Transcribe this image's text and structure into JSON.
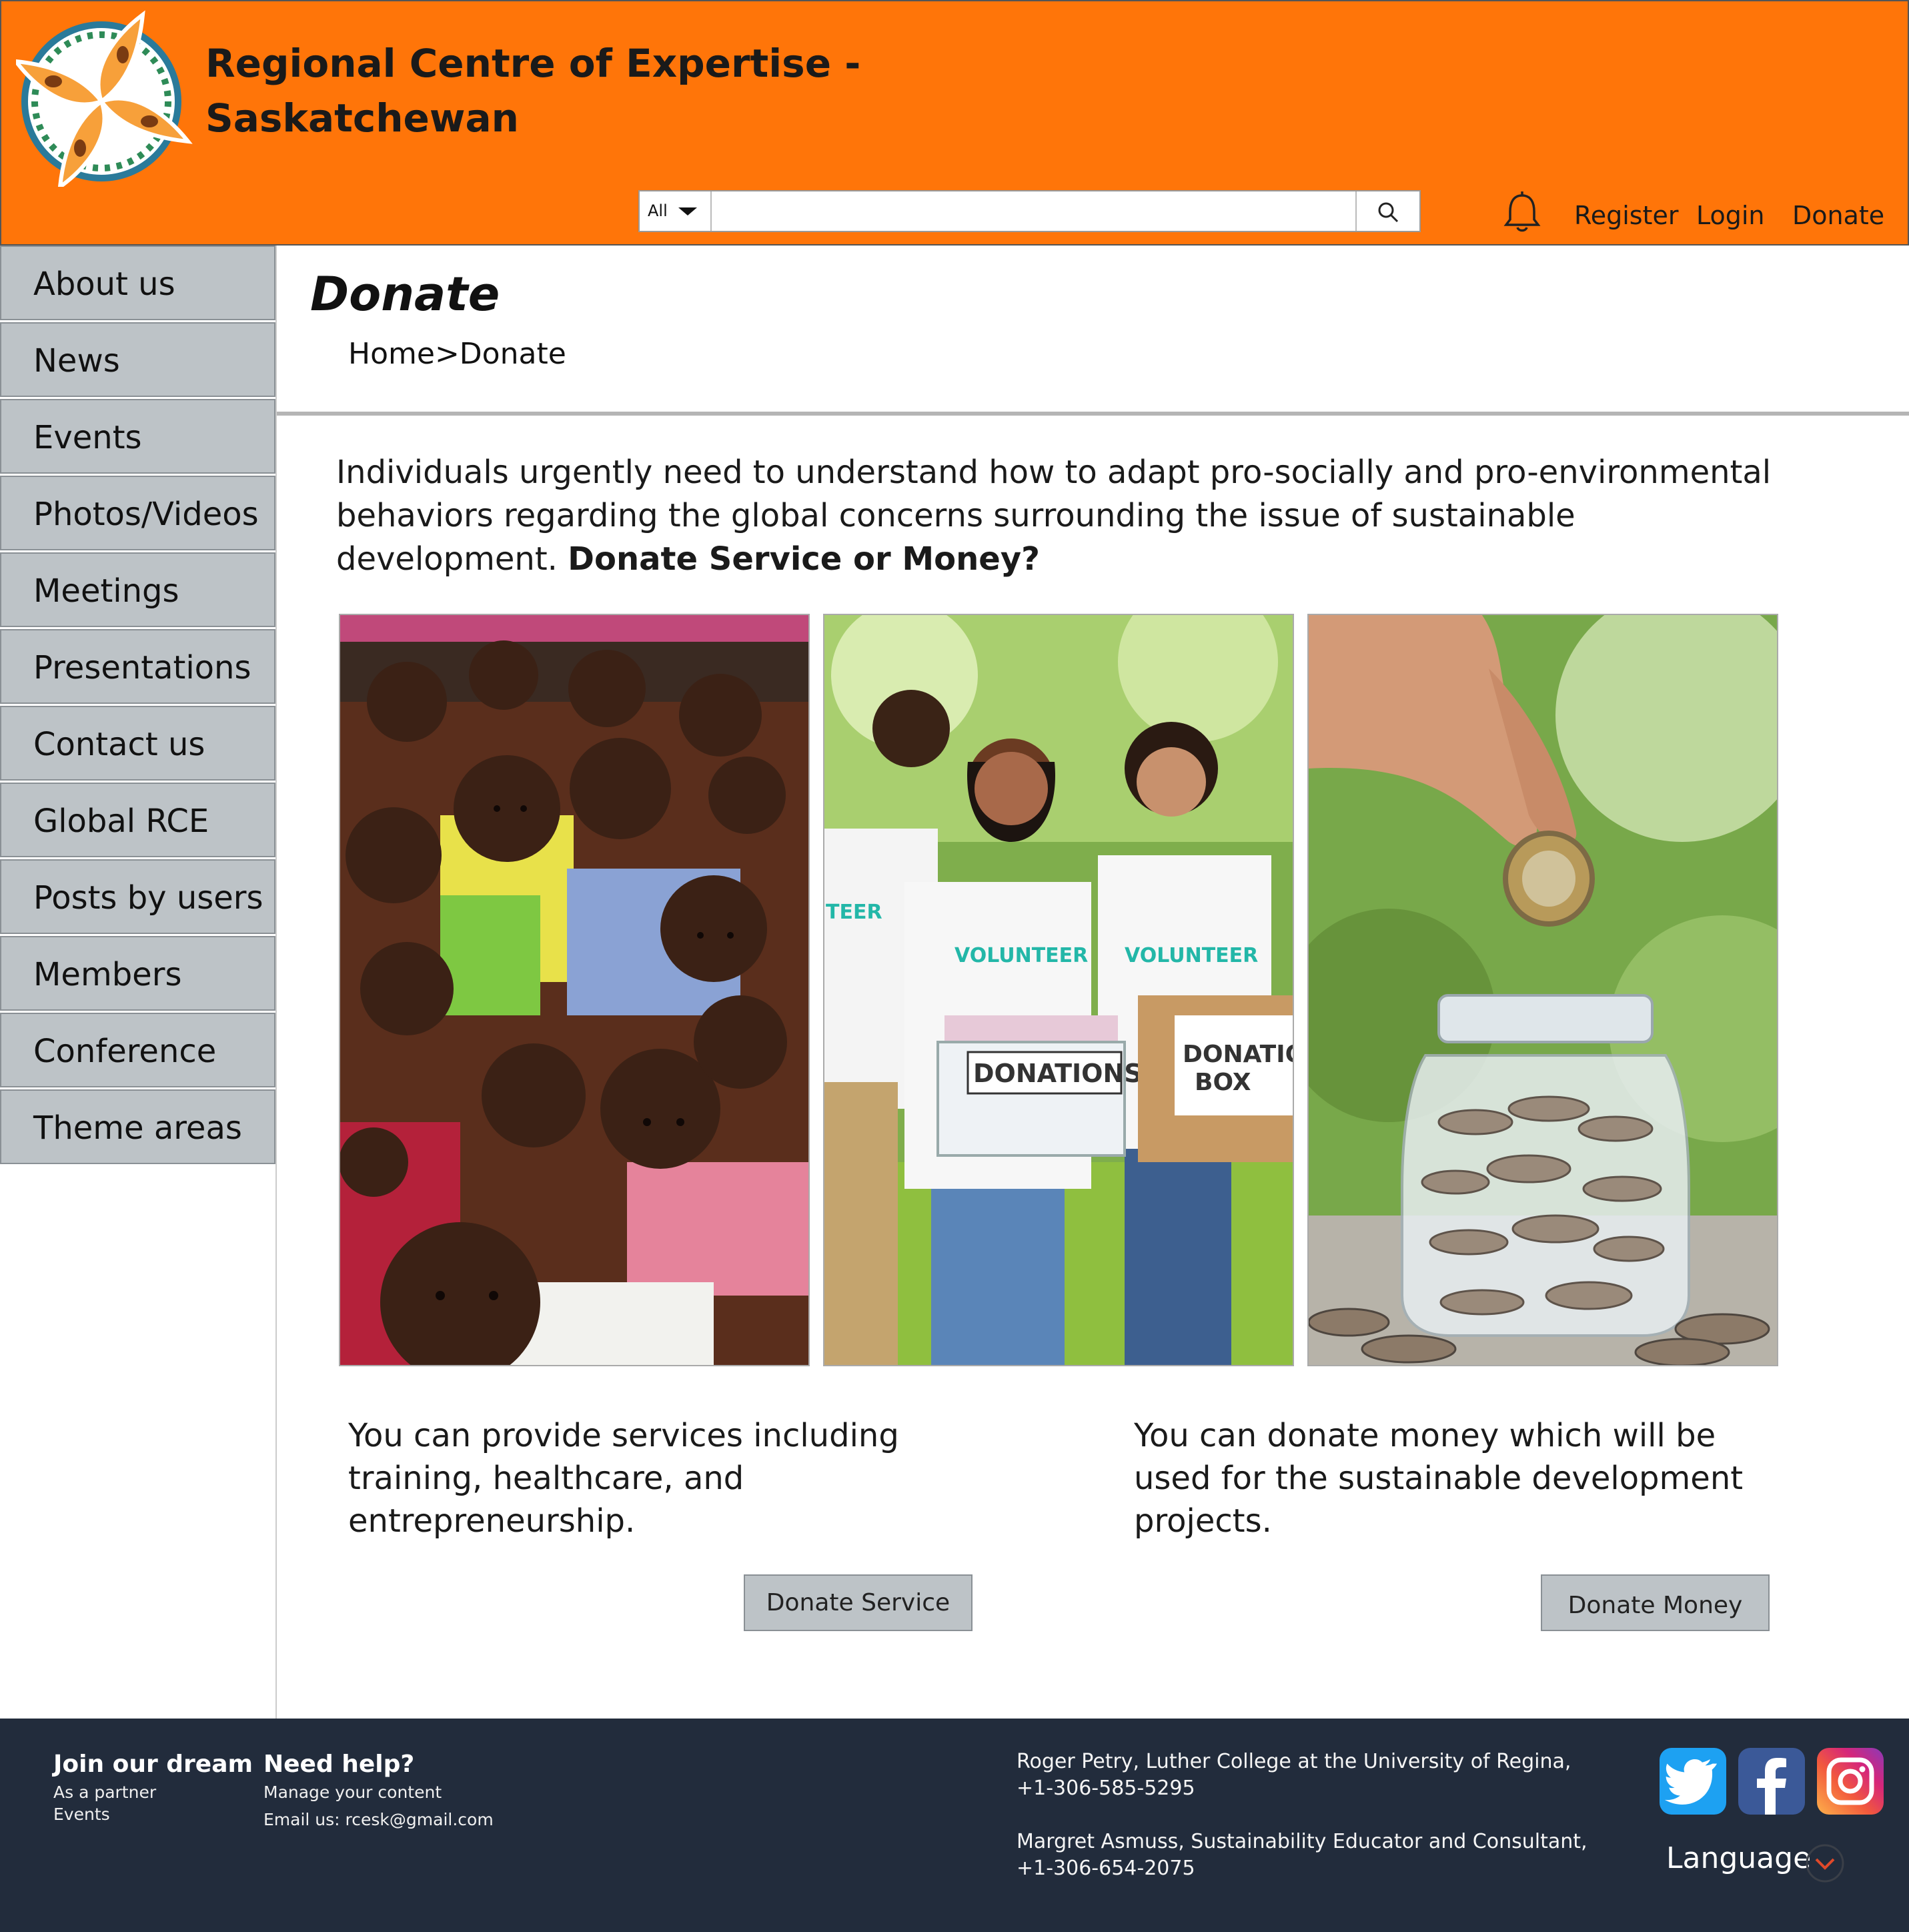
{
  "header": {
    "title_line1": "Regional Centre of Expertise -",
    "title_line2": "Saskatchewan",
    "search": {
      "scope": "All",
      "placeholder": ""
    },
    "links": {
      "register": "Register",
      "login": "Login",
      "donate": "Donate"
    }
  },
  "sidebar": {
    "items": [
      "About us",
      "News",
      "Events",
      "Photos/Videos",
      "Meetings",
      "Presentations",
      "Contact us",
      "Global RCE",
      "Posts by users",
      "Members",
      "Conference",
      "Theme areas"
    ]
  },
  "main": {
    "title": "Donate",
    "breadcrumb": "Home>Donate",
    "intro_text": "Individuals urgently need to understand how to adapt pro-socially and pro-environmental behaviors regarding the global concerns surrounding the issue of sustainable development.",
    "intro_bold": "Donate Service or Money?",
    "photo_labels": {
      "volunteer1": "TEER",
      "volunteer2": "VOLUNTEER",
      "volunteer3": "VOLUNTEER",
      "donations": "DONATIONS",
      "box_line1": "DONATIO",
      "box_line2": "BOX"
    },
    "service_text": "You can provide services including training, healthcare, and entrepreneurship.",
    "money_text": "You can donate money which will be used for the sustainable development projects.",
    "service_button": "Donate Service",
    "money_button": "Donate Money"
  },
  "footer": {
    "join": {
      "heading": "Join our dream",
      "line1": "As a partner",
      "line2": "Events"
    },
    "help": {
      "heading": "Need help?",
      "line1": "Manage your content",
      "line2": "Email us: rcesk@gmail.com"
    },
    "contacts": [
      {
        "name": "Roger Petry, Luther College at the University of Regina,",
        "phone": "+1-306-585-5295"
      },
      {
        "name": "Margret Asmuss, Sustainability Educator and Consultant,",
        "phone": "+1-306-654-2075"
      }
    ],
    "language": "Language",
    "icons": [
      "twitter-icon",
      "facebook-icon",
      "instagram-icon"
    ],
    "colors": {
      "twitter": "#1da1f2",
      "facebook": "#3b5998"
    }
  },
  "colors": {
    "header": "#ff7509",
    "sidebar": "#bdc3c7",
    "footer": "#222c3c"
  }
}
